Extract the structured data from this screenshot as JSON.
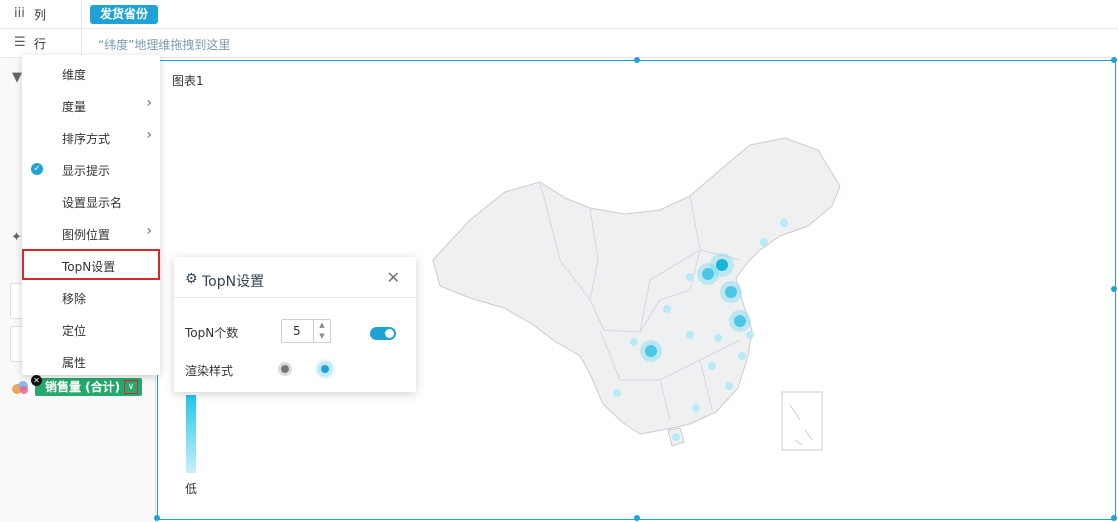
{
  "columns_bar": {
    "icon": "column-bars-icon",
    "icon_glyph": "iii",
    "label": "列",
    "field": "发货省份"
  },
  "rows_bar": {
    "icon": "list-icon",
    "icon_glyph": "☰",
    "label": "行",
    "placeholder": "“纬度”地理维拖拽到这里"
  },
  "context_menu": {
    "items": [
      {
        "label": "维度",
        "has_submenu": false,
        "checked": false
      },
      {
        "label": "度量",
        "has_submenu": true,
        "checked": false
      },
      {
        "label": "排序方式",
        "has_submenu": true,
        "checked": false
      },
      {
        "label": "显示提示",
        "has_submenu": false,
        "checked": true
      },
      {
        "label": "设置显示名",
        "has_submenu": false,
        "checked": false
      },
      {
        "label": "图例位置",
        "has_submenu": true,
        "checked": false
      },
      {
        "label": "TopN设置",
        "has_submenu": false,
        "checked": false,
        "highlighted": true
      },
      {
        "label": "移除",
        "has_submenu": false,
        "checked": false
      },
      {
        "label": "定位",
        "has_submenu": false,
        "checked": false
      },
      {
        "label": "属性",
        "has_submenu": false,
        "checked": false
      }
    ]
  },
  "measure_tag": {
    "label": "销售量 (合计)",
    "color": "#26a96c"
  },
  "chart": {
    "title": "图表1",
    "legend_low": "低"
  },
  "topn_panel": {
    "title": "TopN设置",
    "count_label": "TopN个数",
    "count_value": "5",
    "render_label": "渲染样式",
    "toggle_on": true,
    "render_style_selected": "glow"
  },
  "colors": {
    "accent": "#1fa2d6",
    "highlight_border": "#d42a2a",
    "map_fill": "#eef0f2"
  }
}
